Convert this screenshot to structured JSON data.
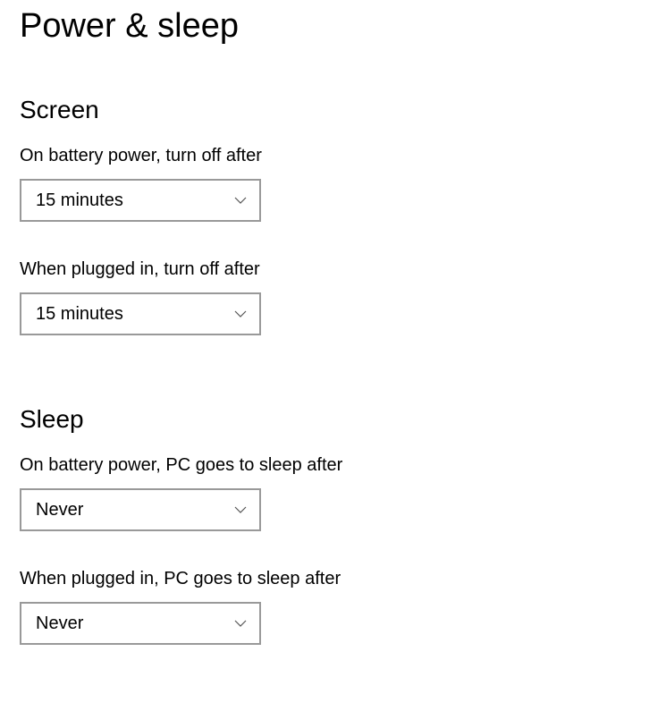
{
  "page_title": "Power & sleep",
  "screen": {
    "heading": "Screen",
    "battery_label": "On battery power, turn off after",
    "battery_value": "15 minutes",
    "plugged_label": "When plugged in, turn off after",
    "plugged_value": "15 minutes"
  },
  "sleep": {
    "heading": "Sleep",
    "battery_label": "On battery power, PC goes to sleep after",
    "battery_value": "Never",
    "plugged_label": "When plugged in, PC goes to sleep after",
    "plugged_value": "Never"
  }
}
